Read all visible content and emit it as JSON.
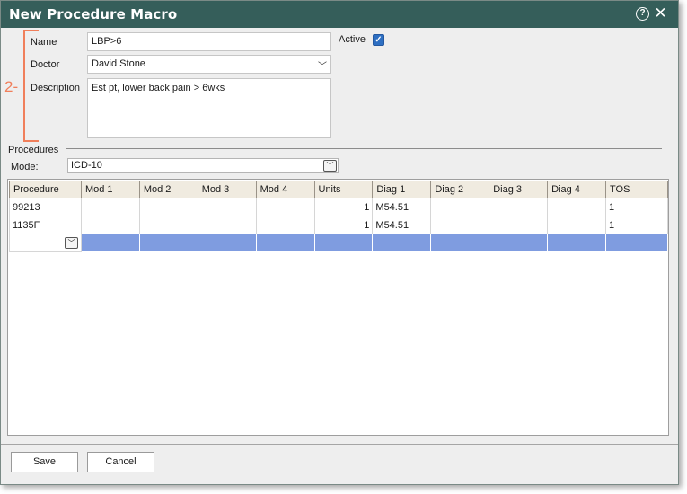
{
  "window": {
    "title": "New Procedure Macro"
  },
  "annotation": {
    "number": "2-"
  },
  "form": {
    "name_label": "Name",
    "name_value": "LBP>6",
    "active_label": "Active",
    "active_checked": true,
    "doctor_label": "Doctor",
    "doctor_value": "David Stone",
    "description_label": "Description",
    "description_value": "Est pt, lower back pain > 6wks"
  },
  "procedures": {
    "section_label": "Procedures",
    "mode_label": "Mode:",
    "mode_value": "ICD-10",
    "columns": [
      "Procedure",
      "Mod 1",
      "Mod 2",
      "Mod 3",
      "Mod 4",
      "Units",
      "Diag 1",
      "Diag 2",
      "Diag 3",
      "Diag 4",
      "TOS"
    ],
    "rows": [
      [
        "99213",
        "",
        "",
        "",
        "",
        "1",
        "M54.51",
        "",
        "",
        "",
        "1"
      ],
      [
        "1135F",
        "",
        "",
        "",
        "",
        "1",
        "M54.51",
        "",
        "",
        "",
        "1"
      ]
    ]
  },
  "footer": {
    "save_label": "Save",
    "cancel_label": "Cancel"
  },
  "colors": {
    "titlebar": "#355e5a",
    "annotation": "#f07f5b",
    "selected_row": "#7f9ce0",
    "checkbox": "#2e6fc2"
  }
}
